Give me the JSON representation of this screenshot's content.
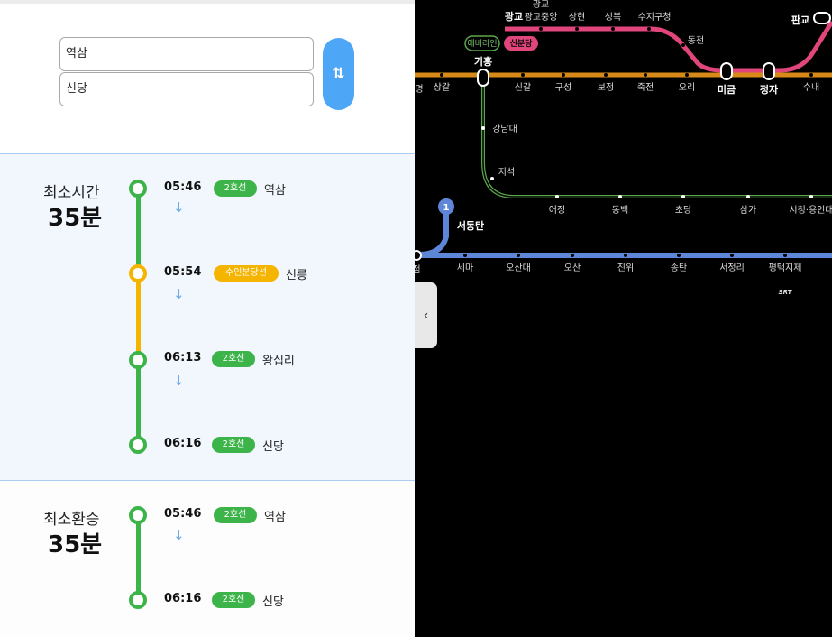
{
  "search": {
    "from": "역삼",
    "to": "신당",
    "swap_icon": "⇅"
  },
  "routes": [
    {
      "label": "최소시간",
      "duration": "35분",
      "stops": [
        {
          "time": "05:46",
          "line": "2호선",
          "name": "역삼"
        },
        {
          "time": "05:54",
          "line": "수인분당선",
          "name": "선릉"
        },
        {
          "time": "06:13",
          "line": "2호선",
          "name": "왕십리"
        },
        {
          "time": "06:16",
          "line": "2호선",
          "name": "신당"
        }
      ]
    },
    {
      "label": "최소환승",
      "duration": "35분",
      "stops": [
        {
          "time": "05:46",
          "line": "2호선",
          "name": "역삼"
        },
        {
          "time": "06:16",
          "line": "2호선",
          "name": "신당"
        }
      ]
    }
  ],
  "down_arrow": "↓",
  "colors": {
    "line2": "#3cb44a",
    "suin_bundang": "#f4b400",
    "accent": "#4ea6f7"
  },
  "map": {
    "collapse_icon": "‹",
    "line_colors": {
      "pink": "#e0457b",
      "orange": "#d78a17",
      "green": "#5aa64a",
      "blue": "#5e86d8"
    },
    "pink_stations": [
      "광교중앙",
      "상현",
      "성복",
      "수지구청",
      "동천"
    ],
    "pink_top_labels": [
      "광교",
      "광교"
    ],
    "big_stations": [
      "광교",
      "판교",
      "기흥",
      "미금",
      "정자"
    ],
    "line_tags": [
      "에버라인",
      "신분당"
    ],
    "orange_stations": [
      "상갈",
      "신갈",
      "구성",
      "보정",
      "죽전",
      "오리",
      "수내"
    ],
    "green_stations": [
      "강남대",
      "지석",
      "어정",
      "동백",
      "초당",
      "삼가",
      "시청·용인대"
    ],
    "blue_stations": [
      "세마",
      "오산대",
      "오산",
      "진위",
      "송탄",
      "서정리",
      "평택지제"
    ],
    "special": {
      "circle_num": "1",
      "circle_station": "서동탄",
      "srt": "SRT",
      "cut_left_1": "명",
      "cut_left_2": "점"
    }
  }
}
